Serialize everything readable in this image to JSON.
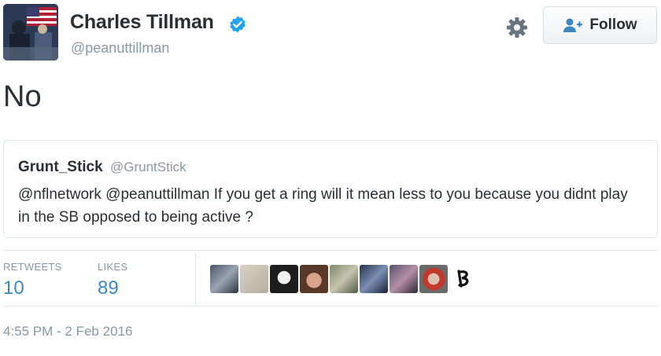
{
  "author": {
    "display_name": "Charles Tillman",
    "handle": "@peanuttillman",
    "verified": true,
    "avatar_icon": "profile-photo"
  },
  "actions": {
    "settings_icon": "gear-icon",
    "follow_label": "Follow",
    "follow_icon": "add-user-icon"
  },
  "tweet": {
    "text": "No"
  },
  "quoted_tweet": {
    "name": "Grunt_Stick",
    "handle": "@GruntStick",
    "text": "@nflnetwork @peanuttillman If you get a ring will it mean less to you because you didnt play in the SB opposed to being active ?"
  },
  "stats": {
    "retweets_label": "RETWEETS",
    "retweets_value": "10",
    "likes_label": "LIKES",
    "likes_value": "89"
  },
  "timestamp": "4:55 PM - 2 Feb 2016",
  "colors": {
    "text": "#292f33",
    "muted": "#8899a6",
    "link": "#3b88c3",
    "verified_badge": "#1da1f2",
    "border": "#e1e8ed"
  }
}
